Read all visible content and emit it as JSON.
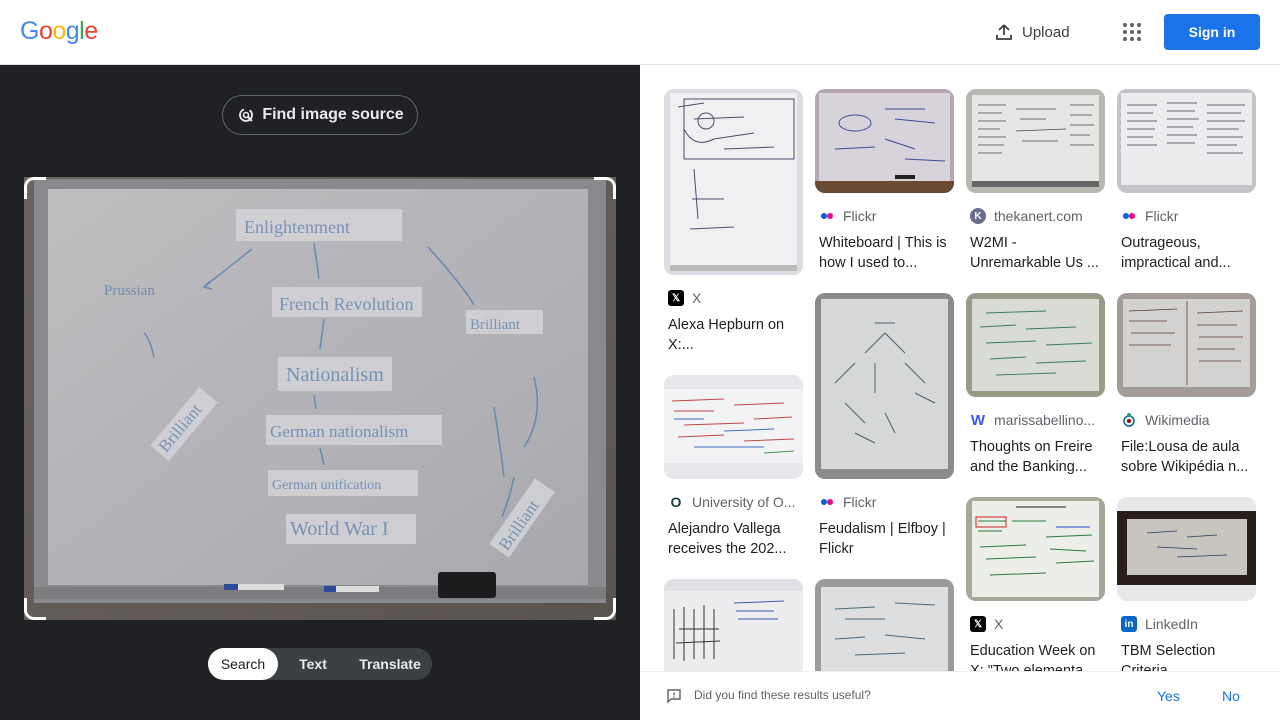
{
  "header": {
    "logo_letters": [
      "G",
      "o",
      "o",
      "g",
      "l",
      "e"
    ],
    "logo_colors": [
      "#4285f4",
      "#ea4335",
      "#fbbc05",
      "#4285f4",
      "#34a853",
      "#ea4335"
    ],
    "upload_label": "Upload",
    "signin_label": "Sign in"
  },
  "left": {
    "find_source_label": "Find image source",
    "tabs": [
      {
        "label": "Search",
        "active": true
      },
      {
        "label": "Text",
        "active": false
      },
      {
        "label": "Translate",
        "active": false
      }
    ],
    "whiteboard_texts": [
      "Enlightenment",
      "Prussian",
      "French Revolution",
      "Nationalism",
      "German nationalism",
      "German unification",
      "World War I",
      "Brilliant",
      "Brilliant"
    ]
  },
  "results": {
    "col1": [
      {
        "source": "X",
        "source_icon": "x-icon",
        "title": "Alexa Hepburn on X:..."
      },
      {
        "source": "University of O...",
        "source_icon": "oregon-o-icon",
        "title": "Alejandro Vallega receives the 202..."
      },
      {
        "source": "",
        "source_icon": "",
        "title": ""
      }
    ],
    "col2": [
      {
        "source": "Flickr",
        "source_icon": "flickr-icon",
        "title": "Whiteboard | This is how I used to..."
      },
      {
        "source": "Flickr",
        "source_icon": "flickr-icon",
        "title": "Feudalism | Elfboy | Flickr"
      },
      {
        "source": "",
        "source_icon": "",
        "title": ""
      }
    ],
    "col3": [
      {
        "source": "thekanert.com",
        "source_icon": "kanert-k-icon",
        "title": "W2MI - Unremarkable Us ..."
      },
      {
        "source": "marissabellino...",
        "source_icon": "wordpress-icon",
        "title": "Thoughts on Freire and the Banking..."
      },
      {
        "source": "X",
        "source_icon": "x-icon",
        "title": "Education Week on X: \"Two elementa..."
      }
    ],
    "col4": [
      {
        "source": "Flickr",
        "source_icon": "flickr-icon",
        "title": "Outrageous, impractical and..."
      },
      {
        "source": "Wikimedia",
        "source_icon": "wikimedia-icon",
        "title": "File:Lousa de aula sobre Wikipédia n..."
      },
      {
        "source": "LinkedIn",
        "source_icon": "linkedin-icon",
        "title": "TBM Selection Criteria"
      }
    ]
  },
  "feedback": {
    "question": "Did you find these results useful?",
    "yes": "Yes",
    "no": "No"
  }
}
